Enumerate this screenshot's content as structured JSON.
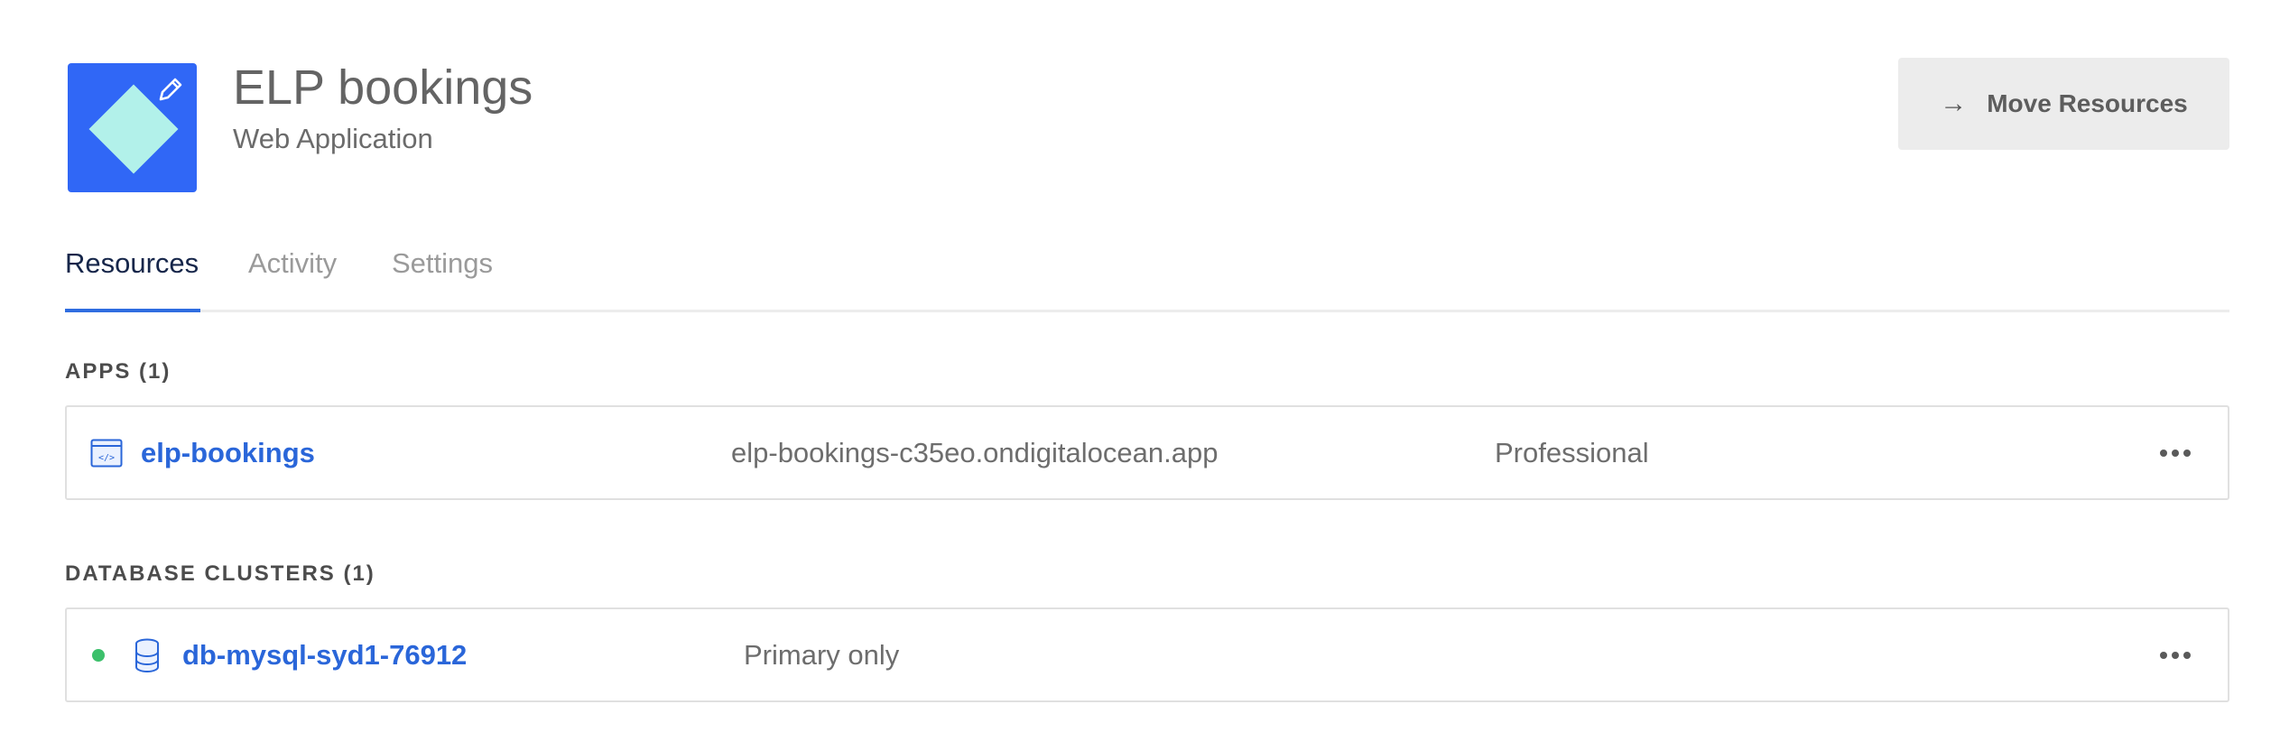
{
  "project": {
    "title": "ELP bookings",
    "subtitle": "Web Application",
    "icon": "diamond-project-icon",
    "icon_color": "#3067f6",
    "icon_accent": "#b2f1ea"
  },
  "header": {
    "move_button_icon": "→",
    "move_button_label": "Move Resources"
  },
  "tabs": [
    {
      "label": "Resources",
      "active": true
    },
    {
      "label": "Activity",
      "active": false
    },
    {
      "label": "Settings",
      "active": false
    }
  ],
  "apps": {
    "heading": "APPS (1)",
    "items": [
      {
        "icon": "app-code-icon",
        "name": "elp-bookings",
        "domain": "elp-bookings-c35eo.ondigitalocean.app",
        "tier": "Professional"
      }
    ]
  },
  "databases": {
    "heading": "DATABASE CLUSTERS (1)",
    "items": [
      {
        "status": "online",
        "status_color": "#3cc06b",
        "icon": "database-icon",
        "name": "db-mysql-syd1-76912",
        "nodes": "Primary only"
      }
    ]
  },
  "colors": {
    "link": "#2a66d9",
    "tab_active_underline": "#2f6de0"
  }
}
